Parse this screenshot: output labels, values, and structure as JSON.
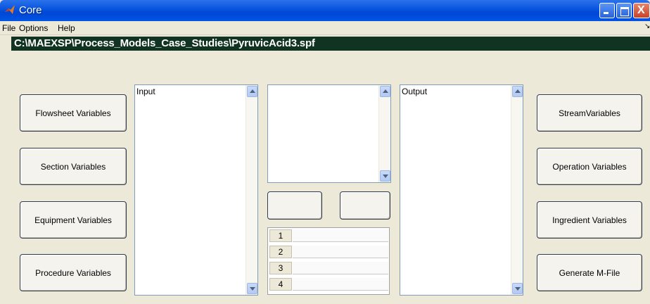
{
  "window": {
    "title": "Core",
    "close_glyph": "X"
  },
  "menu": {
    "file": "File",
    "options": "Options",
    "help": "Help",
    "overflow_glyph": "↘"
  },
  "path": "C:\\MAEXSP\\Process_Models_Case_Studies\\PyruvicAcid3.spf",
  "left_buttons": {
    "flowsheet": "Flowsheet Variables",
    "section": "Section Variables",
    "equipment": "Equipment Variables",
    "procedure": "Procedure Variables"
  },
  "right_buttons": {
    "stream": "StreamVariables",
    "operation": "Operation Variables",
    "ingredient": "Ingredient Variables",
    "generate": "Generate M-File"
  },
  "input_list": {
    "label": "Input"
  },
  "output_list": {
    "label": "Output"
  },
  "table": {
    "rows": [
      "1",
      "2",
      "3",
      "4"
    ]
  },
  "icons": {
    "app": "matlab-logo-icon",
    "minimize": "minimize-icon",
    "maximize": "maximize-icon",
    "close": "close-icon"
  },
  "colors": {
    "titlebar": "#0a57e0",
    "pathbar": "#113322",
    "background": "#ece9d8"
  }
}
